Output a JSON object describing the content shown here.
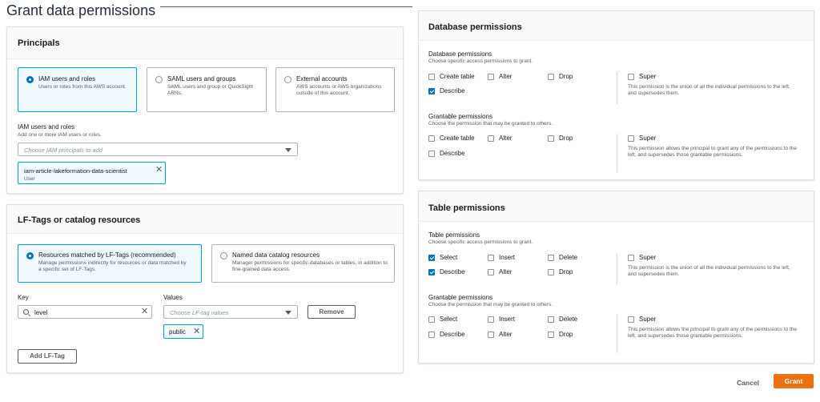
{
  "page": {
    "title": "Grant data permissions"
  },
  "principals": {
    "heading": "Principals",
    "options": [
      {
        "title": "IAM users and roles",
        "desc": "Users or roles from this AWS account.",
        "selected": true
      },
      {
        "title": "SAML users and groups",
        "desc": "SAML users and group or QuickSight ARNs.",
        "selected": false
      },
      {
        "title": "External accounts",
        "desc": "AWS accounts or AWS organizations outside of this account.",
        "selected": false
      }
    ],
    "iam_label": "IAM users and roles",
    "iam_desc": "Add one or more IAM users or roles.",
    "iam_placeholder": "Choose IAM principals to add",
    "token": {
      "name": "iam-article-lakeformation-data-scientist",
      "type": "User"
    }
  },
  "lftags": {
    "heading": "LF-Tags or catalog resources",
    "options": [
      {
        "title": "Resources matched by LF-Tags (recommended)",
        "desc": "Manage permissions indirectly for resources or data matched by a specific set of LF-Tags.",
        "selected": true
      },
      {
        "title": "Named data catalog resources",
        "desc": "Manager permissions for specific databases or tables, in addition to fine-grained data access.",
        "selected": false
      }
    ],
    "key_label": "Key",
    "key_value": "level",
    "values_label": "Values",
    "values_placeholder": "Choose LF-tag values",
    "remove_label": "Remove",
    "value_token": "public",
    "add_label": "Add LF-Tag"
  },
  "db_perms": {
    "heading": "Database permissions",
    "perm_label": "Database permissions",
    "perm_desc": "Choose specific access permissions to grant.",
    "perms": [
      {
        "label": "Create table",
        "checked": false
      },
      {
        "label": "Alter",
        "checked": false
      },
      {
        "label": "Drop",
        "checked": false
      },
      {
        "label": "Describe",
        "checked": true
      }
    ],
    "super_label": "Super",
    "super_desc": "This permission is the union of all the individual permissions to the left, and supersedes them.",
    "grant_label": "Grantable permissions",
    "grant_desc": "Choose the permission that may be granted to others.",
    "grant_perms": [
      {
        "label": "Create table",
        "checked": false
      },
      {
        "label": "Alter",
        "checked": false
      },
      {
        "label": "Drop",
        "checked": false
      },
      {
        "label": "Describe",
        "checked": false
      }
    ],
    "grant_super_label": "Super",
    "grant_super_desc": "This permission allows the principal to grant any of the permissions to the left, and supersedes those grantable permissions."
  },
  "table_perms": {
    "heading": "Table permissions",
    "perm_label": "Table permissions",
    "perm_desc": "Choose specific access permissions to grant.",
    "perms": [
      {
        "label": "Select",
        "checked": true
      },
      {
        "label": "Insert",
        "checked": false
      },
      {
        "label": "Delete",
        "checked": false
      },
      {
        "label": "Describe",
        "checked": true
      },
      {
        "label": "Alter",
        "checked": false
      },
      {
        "label": "Drop",
        "checked": false
      }
    ],
    "super_label": "Super",
    "super_desc": "This permission is the union of all the individual permissions to the left, and supersedes them.",
    "grant_label": "Grantable permissions",
    "grant_desc": "Choose the permission that may be granted to others.",
    "grant_perms": [
      {
        "label": "Select",
        "checked": false
      },
      {
        "label": "Insert",
        "checked": false
      },
      {
        "label": "Delete",
        "checked": false
      },
      {
        "label": "Describe",
        "checked": false
      },
      {
        "label": "Alter",
        "checked": false
      },
      {
        "label": "Drop",
        "checked": false
      }
    ],
    "grant_super_label": "Super",
    "grant_super_desc": "This permission allows the principal to grant any of the permissions to the left, and supersedes those grantable permissions."
  },
  "footer": {
    "cancel": "Cancel",
    "grant": "Grant"
  },
  "colors": {
    "accent": "#0073bb",
    "primary_button": "#ec7211",
    "selected_border": "#00a1c9"
  }
}
